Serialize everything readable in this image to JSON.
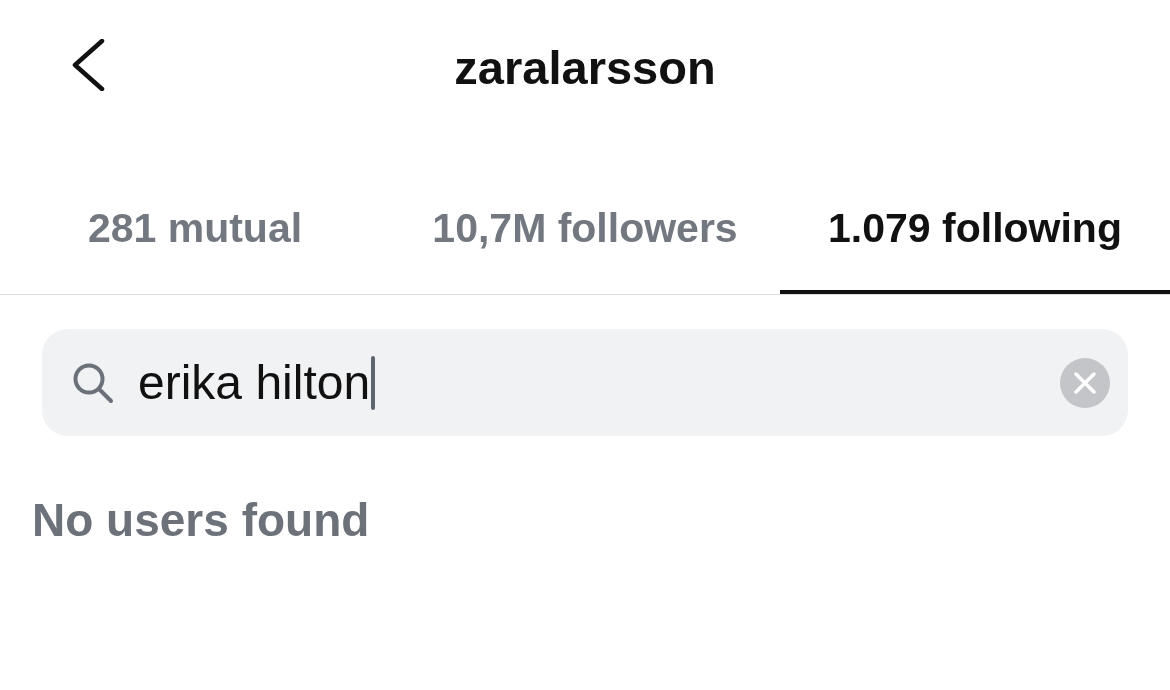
{
  "header": {
    "title": "zaralarsson"
  },
  "tabs": [
    {
      "label": "281 mutual",
      "selected": false
    },
    {
      "label": "10,7M followers",
      "selected": false
    },
    {
      "label": "1.079 following",
      "selected": true
    }
  ],
  "search": {
    "value": "erika hilton",
    "focused": true
  },
  "empty_message": "No users found"
}
